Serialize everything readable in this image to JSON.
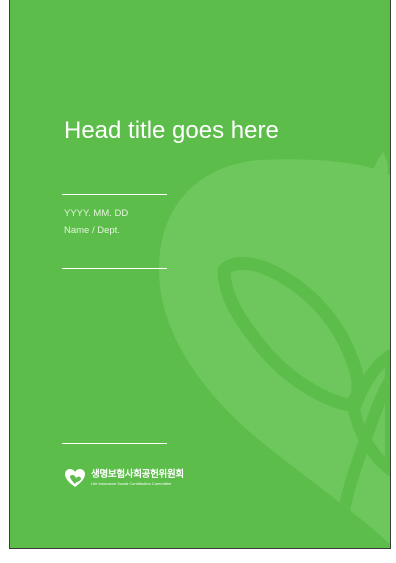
{
  "cover": {
    "title": "Head title goes here",
    "date": "YYYY. MM. DD",
    "name": "Name / Dept.",
    "background_color": "#5cbd4a",
    "watermark_color": "#6dc75d"
  },
  "logo": {
    "icon": "heart-leaf-icon",
    "name_ko": "생명보험사회공헌위원회",
    "name_en": "Life Insurance Social Contribution Committee"
  }
}
